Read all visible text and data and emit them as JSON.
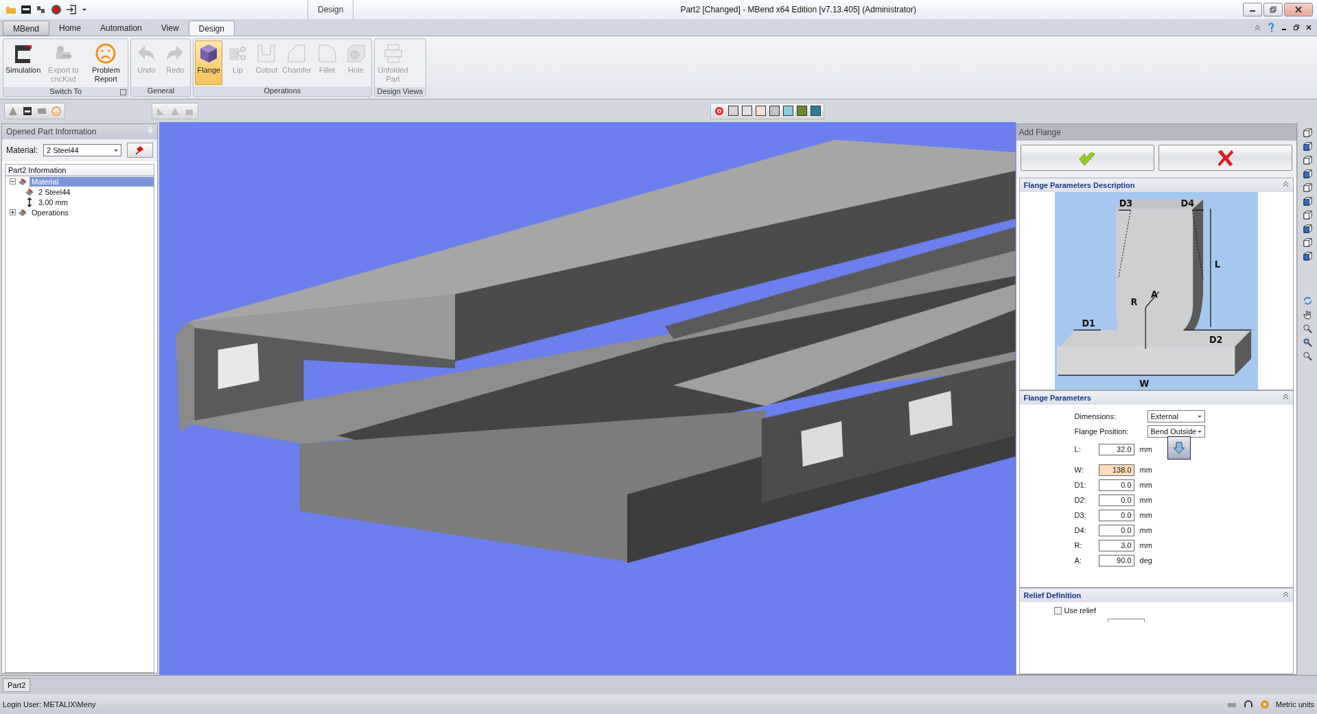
{
  "window": {
    "title": "Part2 [Changed] - MBend x64 Edition [v7.13.405] (Administrator)",
    "context_tab": "Design"
  },
  "ribbon": {
    "tabs": [
      {
        "label": "MBend",
        "selected": false
      },
      {
        "label": "Home",
        "selected": false
      },
      {
        "label": "Automation",
        "selected": false
      },
      {
        "label": "View",
        "selected": false
      },
      {
        "label": "Design",
        "selected": true
      }
    ],
    "groups": [
      {
        "label": "Switch To",
        "buttons": [
          {
            "label": "Simulation",
            "disabled": false,
            "selected": false
          },
          {
            "label": "Export to cncKad",
            "disabled": true,
            "selected": false
          },
          {
            "label": "Problem Report",
            "disabled": false,
            "selected": false
          }
        ]
      },
      {
        "label": "General",
        "buttons": [
          {
            "label": "Undo",
            "disabled": true,
            "selected": false
          },
          {
            "label": "Redo",
            "disabled": true,
            "selected": false
          }
        ]
      },
      {
        "label": "Operations",
        "buttons": [
          {
            "label": "Flange",
            "disabled": false,
            "selected": true
          },
          {
            "label": "Lip",
            "disabled": true,
            "selected": false
          },
          {
            "label": "Cutout",
            "disabled": true,
            "selected": false
          },
          {
            "label": "Chamfer",
            "disabled": true,
            "selected": false
          },
          {
            "label": "Fillet",
            "disabled": true,
            "selected": false
          },
          {
            "label": "Hole",
            "disabled": true,
            "selected": false
          }
        ]
      },
      {
        "label": "Design Views",
        "buttons": [
          {
            "label": "Unfolded Part",
            "disabled": true,
            "selected": false
          }
        ]
      }
    ]
  },
  "color_toolbar": {
    "swatches": [
      {
        "color": "#d4d4d6"
      },
      {
        "color": "#dfe0e6"
      },
      {
        "color": "#f4e0d4"
      },
      {
        "color": "#c2c4ca"
      },
      {
        "color": "#8ccbdc"
      },
      {
        "color": "#6e8b2c"
      },
      {
        "color": "#2c8096"
      }
    ]
  },
  "left_panel": {
    "title": "Opened Part Information",
    "material_label": "Material:",
    "material_value": "2 Steel44",
    "tree_header": "Part2 Information",
    "tree": [
      {
        "label": "Material",
        "selected": true,
        "expanded": true,
        "children": [
          {
            "label": "2 Steel44",
            "selected": false
          },
          {
            "label": "3.00 mm",
            "selected": false
          }
        ]
      },
      {
        "label": "Operations",
        "selected": false,
        "expanded": false
      }
    ]
  },
  "right_panel": {
    "title": "Add Flange",
    "description": {
      "title": "Flange Parameters Description",
      "diagram_labels": [
        "D3",
        "D4",
        "L",
        "R",
        "A",
        "D1",
        "D2",
        "W"
      ]
    },
    "parameters": {
      "title": "Flange Parameters",
      "dimensions_label": "Dimensions:",
      "dimensions_value": "External",
      "position_label": "Flange Position:",
      "position_value": "Bend Outside",
      "fields": [
        {
          "label": "L:",
          "value": "32.0",
          "unit": "mm",
          "highlighted": false
        },
        {
          "label": "W:",
          "value": "138.0",
          "unit": "mm",
          "highlighted": true
        },
        {
          "label": "D1:",
          "value": "0.0",
          "unit": "mm",
          "highlighted": false
        },
        {
          "label": "D2:",
          "value": "0.0",
          "unit": "mm",
          "highlighted": false
        },
        {
          "label": "D3:",
          "value": "0.0",
          "unit": "mm",
          "highlighted": false
        },
        {
          "label": "D4:",
          "value": "0.0",
          "unit": "mm",
          "highlighted": false
        },
        {
          "label": "R:",
          "value": "3.0",
          "unit": "mm",
          "highlighted": false
        },
        {
          "label": "A:",
          "value": "90.0",
          "unit": "deg",
          "highlighted": false
        }
      ]
    },
    "relief": {
      "title": "Relief Definition",
      "use_relief_label": "Use relief",
      "use_relief": false
    }
  },
  "document_tabs": [
    {
      "label": "Part2",
      "selected": true
    }
  ],
  "status_bar": {
    "login": "Login User: METALIX\\Meny",
    "units": "Metric units"
  }
}
